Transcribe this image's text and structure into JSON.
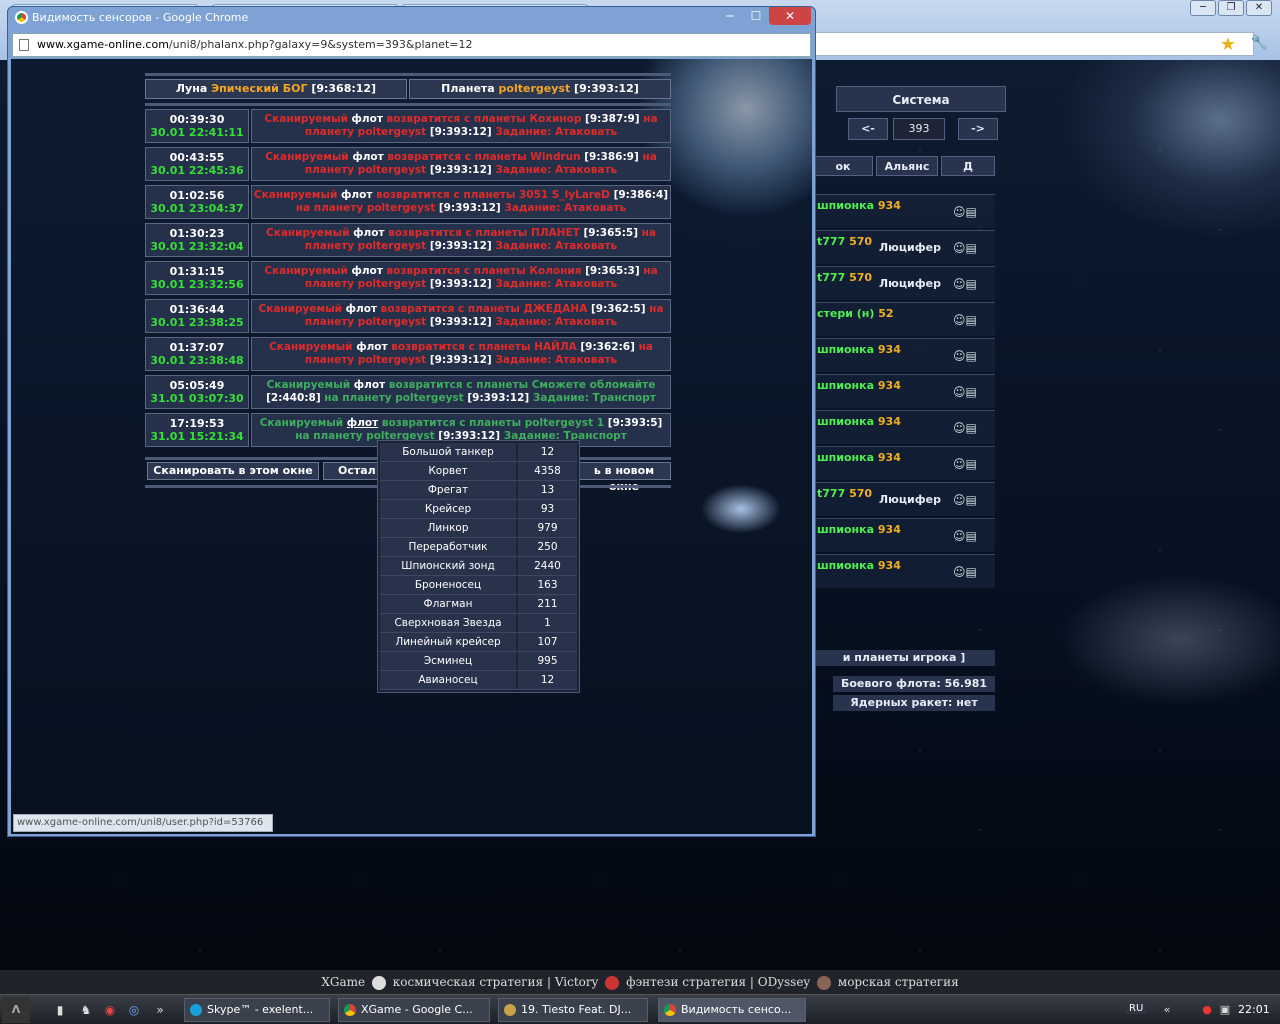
{
  "bg_window": {
    "controls": [
      "─",
      "❐",
      "✕"
    ]
  },
  "bg_galaxy": {
    "system_header": "Система",
    "prev": "<-",
    "system_num": "393",
    "next": "->",
    "col_alliance": "Альянс",
    "col_d": "Д",
    "col_ok": "ок",
    "rows": [
      {
        "n": "шпионка",
        "s": "934",
        "a": ""
      },
      {
        "n": "t777",
        "s": "570",
        "a": "Люцифер"
      },
      {
        "n": "t777",
        "s": "570",
        "a": "Люцифер"
      },
      {
        "n": "стери (н)",
        "s": "52",
        "a": ""
      },
      {
        "n": "шпионка",
        "s": "934",
        "a": ""
      },
      {
        "n": "шпионка",
        "s": "934",
        "a": ""
      },
      {
        "n": "шпионка",
        "s": "934",
        "a": ""
      },
      {
        "n": "шпионка",
        "s": "934",
        "a": ""
      },
      {
        "n": "t777",
        "s": "570",
        "a": "Люцифер"
      },
      {
        "n": "шпионка",
        "s": "934",
        "a": ""
      },
      {
        "n": "шпионка",
        "s": "934",
        "a": ""
      }
    ],
    "planets_link": "и планеты игрока ]",
    "battle_fleet": "Боевого флота: 56.981",
    "nuke": "Ядерных ракет: нет"
  },
  "popup": {
    "title": "Видимость сенсоров - Google Chrome",
    "url_host": "www.xgame-online.com",
    "url_path": "/uni8/phalanx.php?galaxy=9&system=393&planet=12",
    "controls": {
      "min": "─",
      "max": "☐",
      "close": "✕"
    },
    "status_url": "www.xgame-online.com/uni8/user.php?id=53766"
  },
  "phalanx": {
    "moon_label": "Луна",
    "moon_name": "Эпический БОГ",
    "moon_coords": "[9:368:12]",
    "planet_label": "Планета",
    "planet_name": "poltergeyst",
    "planet_coords": "[9:393:12]",
    "fleets": [
      {
        "time": "00:39:30",
        "date": "30.01 22:41:11",
        "c": "red",
        "w1": "Сканируемый",
        "f": "флот",
        "w2": "возвратится с планеты Кохинор",
        "coord": "[9:387:9]",
        "w3": "на",
        "w4": "планету poltergeyst",
        "coord2": "[9:393:12]",
        "w5": "Задание: Атаковать"
      },
      {
        "time": "00:43:55",
        "date": "30.01 22:45:36",
        "c": "red",
        "w1": "Сканируемый",
        "f": "флот",
        "w2": "возвратится с планеты Windrun",
        "coord": "[9:386:9]",
        "w3": "на",
        "w4": "планету poltergeyst",
        "coord2": "[9:393:12]",
        "w5": "Задание: Атаковать"
      },
      {
        "time": "01:02:56",
        "date": "30.01 23:04:37",
        "c": "red",
        "w1": "Сканируемый",
        "f": "флот",
        "w2": "возвратится с планеты 3051 S_lyLareD",
        "coord": "[9:386:4]",
        "w3": "",
        "w4": "на планету poltergeyst",
        "coord2": "[9:393:12]",
        "w5": "Задание: Атаковать"
      },
      {
        "time": "01:30:23",
        "date": "30.01 23:32:04",
        "c": "red",
        "w1": "Сканируемый",
        "f": "флот",
        "w2": "возвратится с планеты ПЛАНЕТ",
        "coord": "[9:365:5]",
        "w3": "на",
        "w4": "планету poltergeyst",
        "coord2": "[9:393:12]",
        "w5": "Задание: Атаковать"
      },
      {
        "time": "01:31:15",
        "date": "30.01 23:32:56",
        "c": "red",
        "w1": "Сканируемый",
        "f": "флот",
        "w2": "возвратится с планеты Колония",
        "coord": "[9:365:3]",
        "w3": "на",
        "w4": "планету poltergeyst",
        "coord2": "[9:393:12]",
        "w5": "Задание: Атаковать"
      },
      {
        "time": "01:36:44",
        "date": "30.01 23:38:25",
        "c": "red",
        "w1": "Сканируемый",
        "f": "флот",
        "w2": "возвратится с планеты ДЖЕДАНА",
        "coord": "[9:362:5]",
        "w3": "на",
        "w4": "планету poltergeyst",
        "coord2": "[9:393:12]",
        "w5": "Задание: Атаковать"
      },
      {
        "time": "01:37:07",
        "date": "30.01 23:38:48",
        "c": "red",
        "w1": "Сканируемый",
        "f": "флот",
        "w2": "возвратится с планеты НАЙЛА",
        "coord": "[9:362:6]",
        "w3": "на",
        "w4": "планету poltergeyst",
        "coord2": "[9:393:12]",
        "w5": "Задание: Атаковать"
      },
      {
        "time": "05:05:49",
        "date": "31.01 03:07:30",
        "c": "grn",
        "w1": "Сканируемый",
        "f": "флот",
        "w2": "возвратится с планеты Сможете обломайте",
        "coord": "[2:440:8]",
        "w3": "на",
        "w4": "планету poltergeyst",
        "coord2": "[9:393:12]",
        "w5": "Задание: Транспорт"
      },
      {
        "time": "17:19:53",
        "date": "31.01 15:21:34",
        "c": "grn",
        "w1": "Сканируемый",
        "f": "флот",
        "w2": "возвратится с планеты poltergeyst 1",
        "coord": "[9:393:5]",
        "w3": "на",
        "w4": "планету poltergeyst",
        "coord2": "[9:393:12]",
        "w5": "Задание: Транспорт"
      }
    ],
    "scan_here": "Сканировать в этом окне",
    "stay": "Остал",
    "scan_new": "ь в новом окне"
  },
  "tooltip": [
    {
      "name": "Большой танкер",
      "count": "12"
    },
    {
      "name": "Корвет",
      "count": "4358"
    },
    {
      "name": "Фрегат",
      "count": "13"
    },
    {
      "name": "Крейсер",
      "count": "93"
    },
    {
      "name": "Линкор",
      "count": "979"
    },
    {
      "name": "Переработчик",
      "count": "250"
    },
    {
      "name": "Шпионский зонд",
      "count": "2440"
    },
    {
      "name": "Броненосец",
      "count": "163"
    },
    {
      "name": "Флагман",
      "count": "211"
    },
    {
      "name": "Сверхновая Звезда",
      "count": "1"
    },
    {
      "name": "Линейный крейсер",
      "count": "107"
    },
    {
      "name": "Эсминец",
      "count": "995"
    },
    {
      "name": "Авианосец",
      "count": "12"
    }
  ],
  "promo": {
    "xgame": "XGame",
    "xgame_desc": "космическая стратегия",
    "sep": "|",
    "victory": "Victory",
    "victory_desc": "фэнтези стратегия",
    "odyssey": "ODyssey",
    "odyssey_desc": "морская стратегия"
  },
  "taskbar": {
    "tasks": [
      "Skype™ - exelent...",
      "XGame - Google C...",
      "19. Tiesto Feat. DJ...",
      "Видимость сенсо..."
    ],
    "lang": "RU",
    "clock": "22:01"
  }
}
